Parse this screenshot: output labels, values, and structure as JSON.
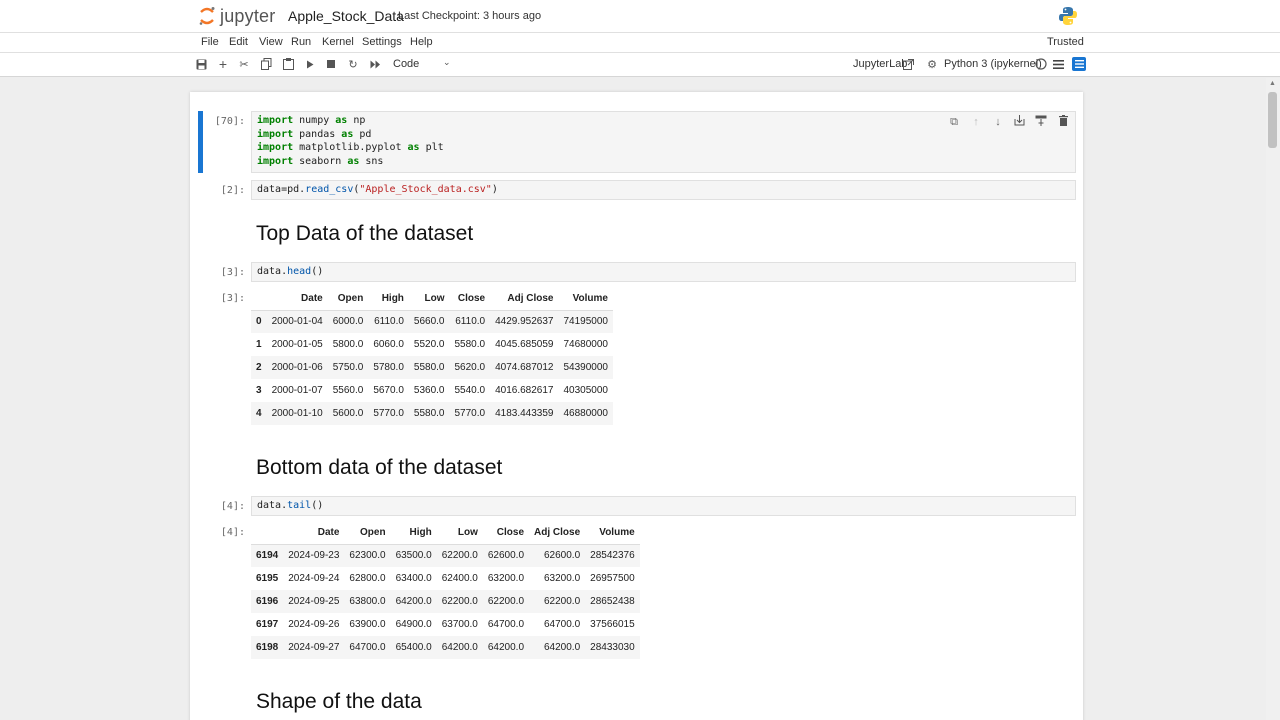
{
  "header": {
    "logo_text": "jupyter",
    "notebook_title": "Apple_Stock_Data",
    "checkpoint": "Last Checkpoint: 3 hours ago",
    "python_logo_icon": "python-logo-icon"
  },
  "menu": {
    "items": [
      "File",
      "Edit",
      "View",
      "Run",
      "Kernel",
      "Settings",
      "Help"
    ],
    "trusted": "Trusted"
  },
  "toolbar": {
    "cell_type": "Code",
    "jupyterlab": "JupyterLab",
    "kernel": "Python 3 (ipykernel)",
    "icons": [
      "save-icon",
      "add-cell-icon",
      "cut-icon",
      "copy-icon",
      "paste-icon",
      "run-icon",
      "stop-icon",
      "restart-icon",
      "run-all-icon"
    ]
  },
  "cells": {
    "c1": {
      "prompt": "[70]:"
    },
    "c2": {
      "prompt": "[2]:"
    },
    "c3": {
      "prompt": "[3]:",
      "out_prompt": "[3]:"
    },
    "c4": {
      "prompt": "[4]:",
      "out_prompt": "[4]:"
    }
  },
  "markdown": {
    "h1": "Top Data of the dataset",
    "h2": "Bottom data of the dataset",
    "h3": "Shape of the data"
  },
  "head_table": {
    "columns": [
      "",
      "Date",
      "Open",
      "High",
      "Low",
      "Close",
      "Adj Close",
      "Volume"
    ],
    "rows": [
      [
        "0",
        "2000-01-04",
        "6000.0",
        "6110.0",
        "5660.0",
        "6110.0",
        "4429.952637",
        "74195000"
      ],
      [
        "1",
        "2000-01-05",
        "5800.0",
        "6060.0",
        "5520.0",
        "5580.0",
        "4045.685059",
        "74680000"
      ],
      [
        "2",
        "2000-01-06",
        "5750.0",
        "5780.0",
        "5580.0",
        "5620.0",
        "4074.687012",
        "54390000"
      ],
      [
        "3",
        "2000-01-07",
        "5560.0",
        "5670.0",
        "5360.0",
        "5540.0",
        "4016.682617",
        "40305000"
      ],
      [
        "4",
        "2000-01-10",
        "5600.0",
        "5770.0",
        "5580.0",
        "5770.0",
        "4183.443359",
        "46880000"
      ]
    ]
  },
  "tail_table": {
    "columns": [
      "",
      "Date",
      "Open",
      "High",
      "Low",
      "Close",
      "Adj Close",
      "Volume"
    ],
    "rows": [
      [
        "6194",
        "2024-09-23",
        "62300.0",
        "63500.0",
        "62200.0",
        "62600.0",
        "62600.0",
        "28542376"
      ],
      [
        "6195",
        "2024-09-24",
        "62800.0",
        "63400.0",
        "62400.0",
        "63200.0",
        "63200.0",
        "26957500"
      ],
      [
        "6196",
        "2024-09-25",
        "63800.0",
        "64200.0",
        "62200.0",
        "62200.0",
        "62200.0",
        "28652438"
      ],
      [
        "6197",
        "2024-09-26",
        "63900.0",
        "64900.0",
        "63700.0",
        "64700.0",
        "64700.0",
        "37566015"
      ],
      [
        "6198",
        "2024-09-27",
        "64700.0",
        "65400.0",
        "64200.0",
        "64200.0",
        "64200.0",
        "28433030"
      ]
    ]
  },
  "colors": {
    "active_cell": "#1976d2",
    "jupyter_orange": "#f37626",
    "keyword": "#008000",
    "string": "#ba2121"
  }
}
